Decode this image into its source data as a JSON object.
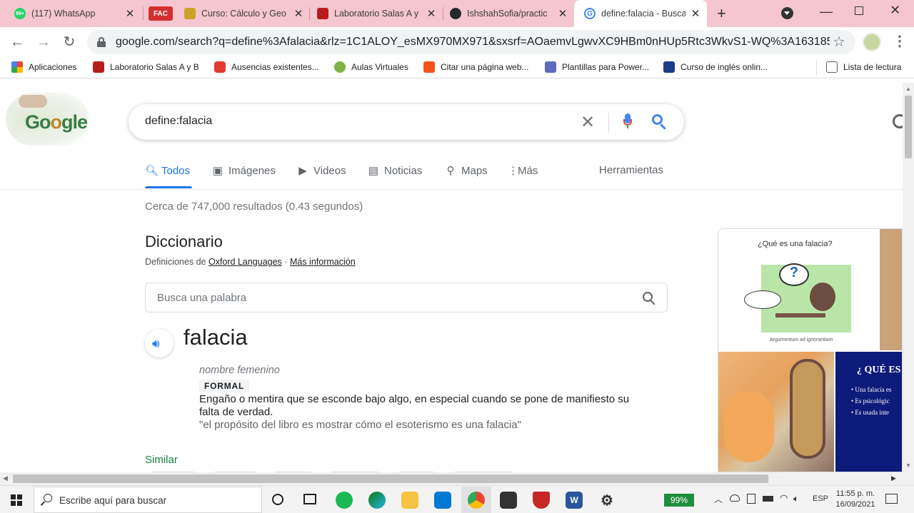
{
  "tabs": [
    {
      "title": "(117) WhatsApp",
      "badge": "99+"
    },
    {
      "title": "",
      "badge": "FAC"
    },
    {
      "title": "Curso: Cálculo y Geo",
      "badge": ""
    },
    {
      "title": "Laboratorio Salas A y",
      "badge": ""
    },
    {
      "title": "IshshahSofia/practic",
      "badge": ""
    },
    {
      "title": "define:falacia - Busca",
      "badge": ""
    }
  ],
  "address_bar": {
    "url": "google.com/search?q=define%3Afalacia&rlz=1C1ALOY_esMX970MX971&sxsrf=AOaemvLgwvXC9HBm0nHUp5Rtc3WkvS1-WQ%3A16318544..."
  },
  "bookmarks": {
    "items": [
      "Aplicaciones",
      "Laboratorio Salas A y B",
      "Ausencias existentes...",
      "Aulas Virtuales",
      "Citar una página web...",
      "Plantillas para Power...",
      "Curso de inglés onlin..."
    ],
    "reading_list": "Lista de lectura"
  },
  "search": {
    "query": "define:falacia",
    "tabs": [
      "Todos",
      "Imágenes",
      "Videos",
      "Noticias",
      "Maps",
      "Más"
    ],
    "tools": "Herramientas",
    "result_stats": "Cerca de 747,000 resultados (0.43 segundos)"
  },
  "dictionary": {
    "heading": "Diccionario",
    "source_prefix": "Definiciones de",
    "source": "Oxford Languages",
    "separator": "·",
    "more_info": "Más información",
    "lookup_placeholder": "Busca una palabra",
    "word": "falacia",
    "pos": "nombre femenino",
    "register": "FORMAL",
    "definition_1": "Engaño o mentira que se esconde bajo algo, en especial cuando se pone de manifiesto su",
    "definition_2": "falta de verdad.",
    "example": "\"el propósito del libro es mostrar cómo el esoterismo es una falacia\"",
    "similar": "Similar"
  },
  "images": {
    "card_title": "¿Qué es una falacia?",
    "bubble_text": "Argumentum ad ignorantiam",
    "slide_title": "¿ QUÉ ES",
    "slide_bullets": [
      "Una falacia es",
      "Es psicológic",
      "Es usada inte"
    ]
  },
  "taskbar": {
    "search_placeholder": "Escribe aquí para buscar",
    "battery": "99%",
    "lang": "ESP",
    "time": "11:55 p. m.",
    "date": "16/09/2021"
  },
  "colors": {
    "tabstrip": "#f5c6cf",
    "google_blue": "#1a73e8",
    "link": "#202124"
  }
}
